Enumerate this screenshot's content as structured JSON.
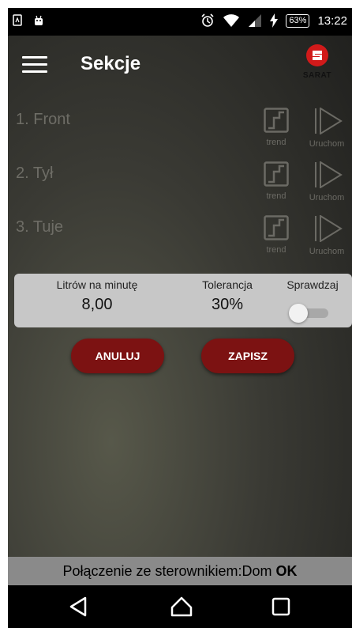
{
  "status_bar": {
    "time": "13:22",
    "battery_percent": "63%",
    "icons": [
      "sim-icon",
      "android-icon",
      "alarm-icon",
      "wifi-icon",
      "signal-icon",
      "charging-icon",
      "battery-icon"
    ]
  },
  "toolbar": {
    "title": "Sekcje",
    "logo_text": "SARAT",
    "menu_icon": "menu-icon"
  },
  "sections": [
    {
      "label": "1. Front",
      "trend_label": "trend",
      "run_label": "Uruchom"
    },
    {
      "label": "2. Tył",
      "trend_label": "trend",
      "run_label": "Uruchom"
    },
    {
      "label": "3. Tuje",
      "trend_label": "trend",
      "run_label": "Uruchom"
    }
  ],
  "settings": {
    "flow_label": "Litrów na minutę",
    "flow_value": "8,00",
    "tolerance_label": "Tolerancja",
    "tolerance_value": "30%",
    "check_label": "Sprawdzaj",
    "check_enabled": false
  },
  "actions": {
    "cancel_label": "ANULUJ",
    "save_label": "ZAPISZ"
  },
  "connection": {
    "prefix": "Połączenie ze sterownikiem:Dom ",
    "status": "OK"
  },
  "colors": {
    "accent": "#7c1212",
    "logo_red": "#d11a1a",
    "panel": "#c7c7c7"
  }
}
